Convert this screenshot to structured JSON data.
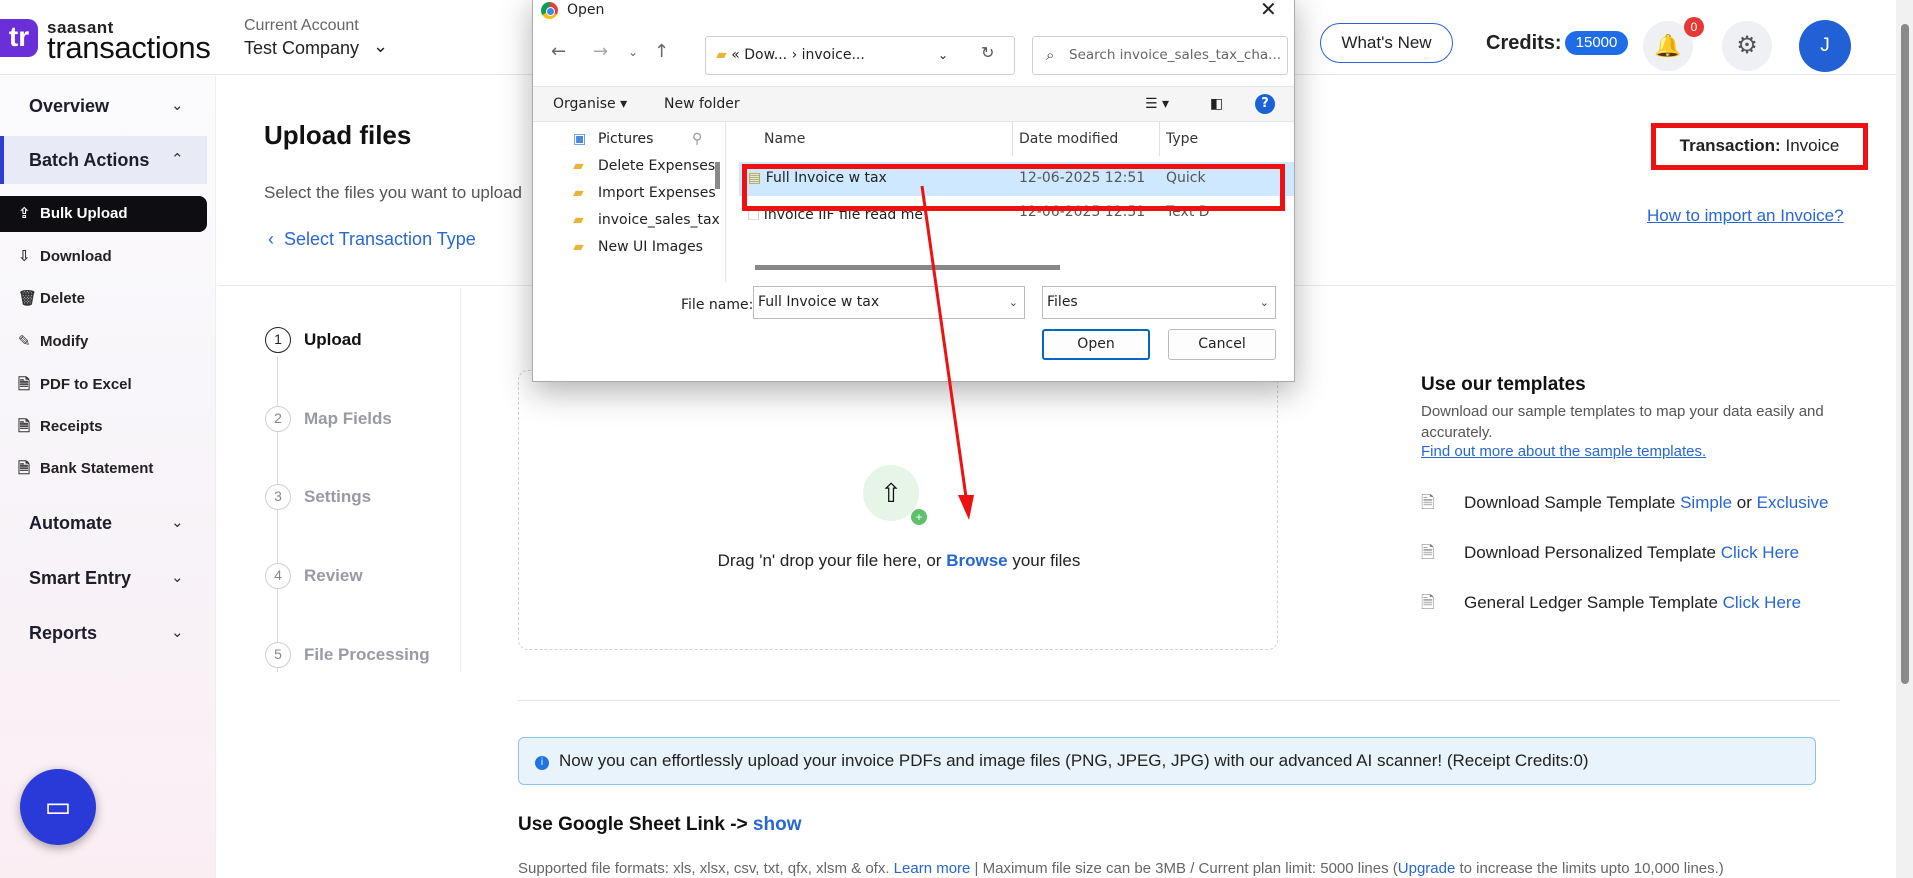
{
  "header": {
    "logo_mark": "tr",
    "logo_small": "saasant",
    "logo_big": "transactions",
    "account_label": "Current Account",
    "account_value": "Test Company",
    "whats_new": "What's New",
    "credits_label": "Credits:",
    "credits_value": "15000",
    "notifications_count": "0",
    "avatar_initial": "J"
  },
  "sidebar": {
    "overview": "Overview",
    "batch_actions": "Batch Actions",
    "items": [
      {
        "label": "Bulk Upload",
        "icon": "cloud-upload-icon"
      },
      {
        "label": "Download",
        "icon": "cloud-download-icon"
      },
      {
        "label": "Delete",
        "icon": "trash-icon"
      },
      {
        "label": "Modify",
        "icon": "pen-icon"
      },
      {
        "label": "PDF to Excel",
        "icon": "document-icon"
      },
      {
        "label": "Receipts",
        "icon": "document-icon"
      },
      {
        "label": "Bank Statement",
        "icon": "document-icon"
      }
    ],
    "automate": "Automate",
    "smart_entry": "Smart Entry",
    "reports": "Reports"
  },
  "main": {
    "title": "Upload files",
    "subtitle": "Select the files you want to upload",
    "back_link": "Select Transaction Type",
    "transaction_label": "Transaction:",
    "transaction_value": "Invoice",
    "howto_link": "How to import an Invoice?",
    "steps": [
      {
        "num": "1",
        "label": "Upload"
      },
      {
        "num": "2",
        "label": "Map Fields"
      },
      {
        "num": "3",
        "label": "Settings"
      },
      {
        "num": "4",
        "label": "Review"
      },
      {
        "num": "5",
        "label": "File Processing"
      }
    ],
    "dropzone": {
      "text_before": "Drag 'n' drop your file here, or ",
      "browse": "Browse",
      "text_after": " your files"
    },
    "templates": {
      "title": "Use our templates",
      "desc": "Download our sample templates to map your data easily and accurately.",
      "link": "Find out more about the sample templates.",
      "row1_text": "Download Sample Template ",
      "row1_link1": "Simple",
      "row1_or": " or ",
      "row1_link2": "Exclusive",
      "row2_text": "Download Personalized Template ",
      "row2_link": "Click Here",
      "row3_text": "General Ledger Sample Template ",
      "row3_link": "Click Here"
    },
    "info_bar": "Now you can effortlessly upload your invoice PDFs and image files (PNG, JPEG, JPG) with our advanced AI scanner! (Receipt Credits:0)",
    "gsheet_label": "Use Google Sheet Link -> ",
    "gsheet_show": "show",
    "formats_text": "Supported file formats: xls, xlsx, csv, txt, qfx, xlsm & ofx. ",
    "formats_learn": "Learn more",
    "formats_mid": " | Maximum file size can be 3MB / Current plan limit: 5000 lines (",
    "formats_upgrade": "Upgrade",
    "formats_end": " to increase the limits upto 10,000 lines.)"
  },
  "dialog": {
    "title": "Open",
    "address_1": "Dow...",
    "address_2": "invoice...",
    "search_placeholder": "Search invoice_sales_tax_cha...",
    "organise": "Organise",
    "new_folder": "New folder",
    "tree": [
      "Pictures",
      "Delete Expenses",
      "Import Expenses",
      "invoice_sales_tax",
      "New UI Images"
    ],
    "columns": {
      "name": "Name",
      "date": "Date modified",
      "type": "Type"
    },
    "files": [
      {
        "name": "Full Invoice w tax",
        "date": "12-06-2025 12:51",
        "type": "Quick"
      },
      {
        "name": "Invoice IIF file read me",
        "date": "12-06-2025 12:51",
        "type": "Text D"
      }
    ],
    "filename_label": "File name:",
    "filename_value": "Full Invoice w tax",
    "filetype_value": "Files",
    "open_btn": "Open",
    "cancel_btn": "Cancel"
  },
  "colors": {
    "accent": "#2767d2",
    "brand": "#6b2fd9",
    "highlight_red": "#ee1111",
    "nav_active_bg": "#0e0e12"
  }
}
